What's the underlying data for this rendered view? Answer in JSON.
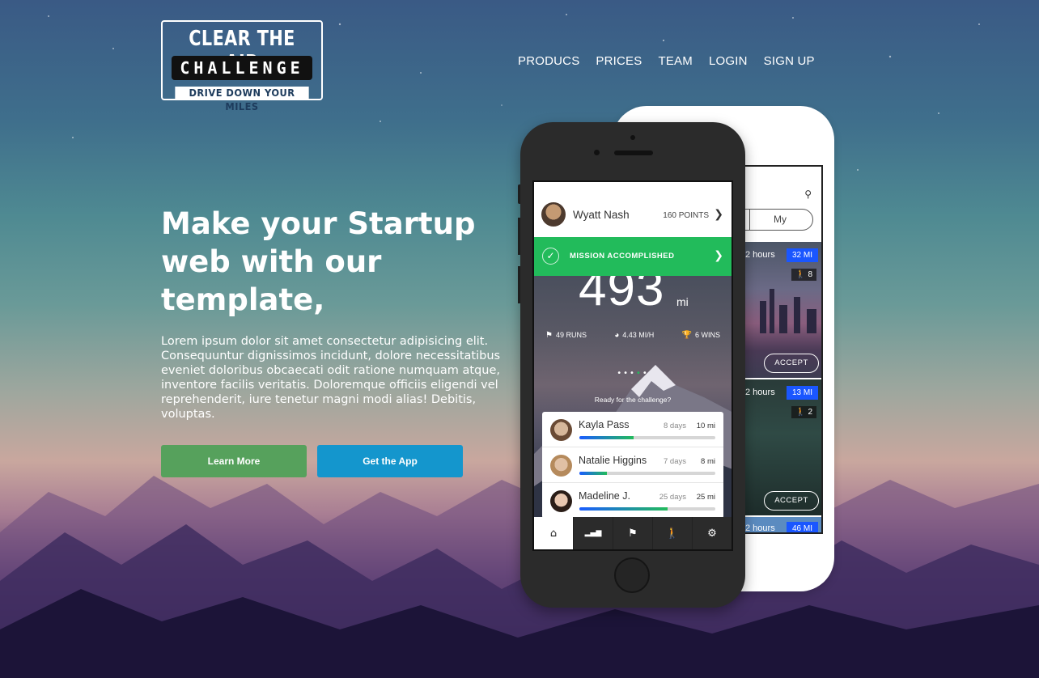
{
  "logo": {
    "line1": "CLEAR THE AIR",
    "line2": "CHALLENGE",
    "line3": "DRIVE DOWN YOUR MILES"
  },
  "nav": [
    "PRODUCS",
    "PRICES",
    "TEAM",
    "LOGIN",
    "SIGN UP"
  ],
  "hero": {
    "title": "Make your Startup web with our template,",
    "text": "Lorem ipsum dolor sit amet consectetur adipisicing elit. Consequuntur dignissimos incidunt, dolore necessitatibus eveniet doloribus obcaecati odit ratione numquam atque, inventore facilis veritatis. Doloremque officiis eligendi vel reprehenderit, iure tenetur magni modi alias! Debitis, voluptas.",
    "learn_more": "Learn More",
    "get_app": "Get the App"
  },
  "front_phone": {
    "user_name": "Wyatt Nash",
    "points": "160 POINTS",
    "mission": "MISSION ACCOMPLISHED",
    "big_number": "493",
    "big_unit": "mi",
    "runs": "49 RUNS",
    "speed": "4.43 MI/H",
    "wins": "6 WINS",
    "ready": "Ready for the challenge?",
    "leaders": [
      {
        "name": "Kayla Pass",
        "days": "8 days",
        "mi": "10 mi",
        "progress": 0.4
      },
      {
        "name": "Natalie Higgins",
        "days": "7 days",
        "mi": "8 mi",
        "progress": 0.2
      },
      {
        "name": "Madeline J.",
        "days": "25 days",
        "mi": "25 mi",
        "progress": 0.65
      }
    ]
  },
  "back_phone": {
    "toggle_label": "My",
    "cards": [
      {
        "hours": "2 hours",
        "mi": "32 MI",
        "people": "8",
        "accept": "ACCEPT"
      },
      {
        "hours": "2 hours",
        "mi": "13 MI",
        "people": "2",
        "accept": "ACCEPT"
      },
      {
        "hours": "2 hours",
        "mi": "46 MI"
      }
    ]
  },
  "colors": {
    "green": "#22bb5b",
    "learn_btn": "#56a15c",
    "app_btn": "#1496cd",
    "mi_badge": "#1a56ff"
  }
}
